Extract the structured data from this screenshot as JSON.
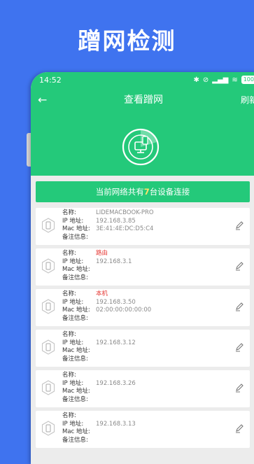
{
  "headline": "蹭网检测",
  "status_bar": {
    "time": "14:52",
    "battery": "100"
  },
  "nav": {
    "title": "查看蹭网",
    "refresh_label": "刷新"
  },
  "banner": {
    "prefix": "当前网络共有",
    "count": "7",
    "suffix": "台设备连接"
  },
  "field_labels": {
    "name": "名称:",
    "ip": "IP 地址:",
    "mac": "Mac 地址:",
    "note": "备注信息:"
  },
  "devices": [
    {
      "name": "LIDEMACBOOK-PRO",
      "ip": "192.168.3.85",
      "mac": "3E:41:4E:DC:D5:C4",
      "note": "",
      "name_color": "#8a8a8a"
    },
    {
      "name": "路由",
      "ip": "192.168.3.1",
      "mac": "",
      "note": "",
      "name_color": "#e53935"
    },
    {
      "name": "本机",
      "ip": "192.168.3.50",
      "mac": "02:00:00:00:00:00",
      "note": "",
      "name_color": "#e53935"
    },
    {
      "name": "",
      "ip": "192.168.3.12",
      "mac": "",
      "note": "",
      "name_color": "#8a8a8a"
    },
    {
      "name": "",
      "ip": "192.168.3.26",
      "mac": "",
      "note": "",
      "name_color": "#8a8a8a"
    },
    {
      "name": "",
      "ip": "192.168.3.13",
      "mac": "",
      "note": "",
      "name_color": "#8a8a8a"
    }
  ],
  "icons": [
    "back-arrow-icon",
    "radar-scan-icon",
    "device-icon",
    "edit-pencil-icon"
  ],
  "colors": {
    "brand_green": "#24c97a",
    "background_blue": "#3f73ef",
    "highlight_red": "#e53935"
  }
}
